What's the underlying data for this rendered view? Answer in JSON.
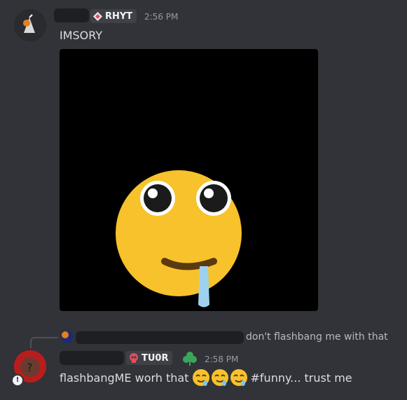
{
  "message1": {
    "role_tag": "RHYT",
    "timestamp": "2:56 PM",
    "text": "IMSORY"
  },
  "reply": {
    "quoted_text": "don't flashbang me with that"
  },
  "message2": {
    "role_tag": "TU0R",
    "timestamp": "2:58 PM",
    "text_before": "flashbangME worh that",
    "text_after": "#funny... trust me"
  },
  "colors": {
    "background": "#313338",
    "redaction": "#1e1f22",
    "tag_bg": "#3f4147",
    "emoji_yellow": "#f7c22b"
  }
}
